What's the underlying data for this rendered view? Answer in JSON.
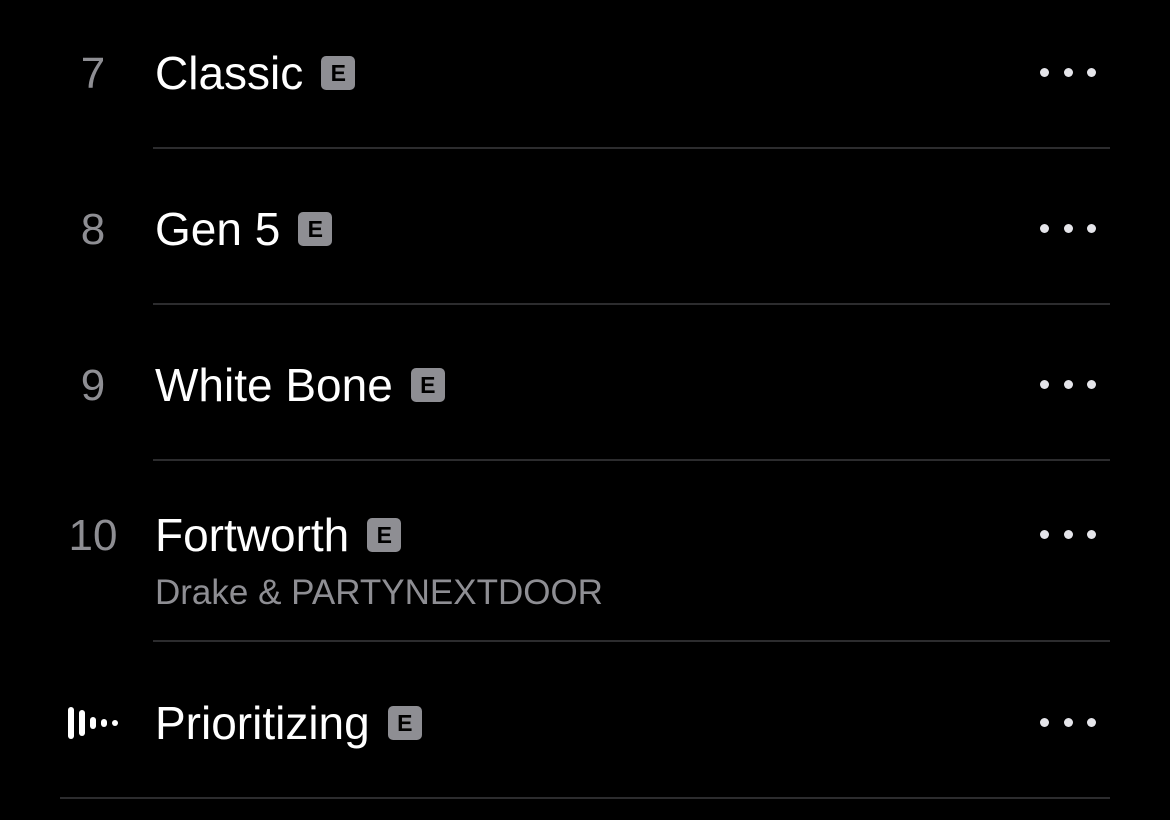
{
  "tracks": [
    {
      "number": "7",
      "title": "Classic",
      "explicit_label": "E",
      "artist": ""
    },
    {
      "number": "8",
      "title": "Gen 5",
      "explicit_label": "E",
      "artist": ""
    },
    {
      "number": "9",
      "title": "White Bone",
      "explicit_label": "E",
      "artist": ""
    },
    {
      "number": "10",
      "title": "Fortworth",
      "explicit_label": "E",
      "artist": "Drake & PARTYNEXTDOOR"
    },
    {
      "number": "",
      "title": "Prioritizing",
      "explicit_label": "E",
      "artist": "",
      "now_playing": true
    }
  ],
  "icons": {
    "more": "more-options-icon",
    "now_playing": "now-playing-equalizer-icon",
    "explicit": "explicit-badge"
  },
  "colors": {
    "background": "#000000",
    "title": "#ffffff",
    "secondary": "#8e8e93",
    "divider": "#2c2c2e"
  }
}
